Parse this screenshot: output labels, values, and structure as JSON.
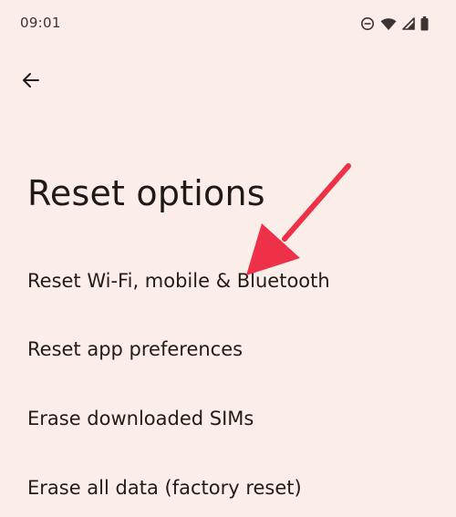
{
  "status_bar": {
    "time": "09:01",
    "icons": [
      "do-not-disturb-icon",
      "wifi-icon",
      "cellular-signal-icon",
      "battery-icon"
    ]
  },
  "header": {
    "back_icon": "arrow-left-icon"
  },
  "page": {
    "title": "Reset options"
  },
  "options": [
    {
      "label": "Reset Wi-Fi, mobile & Bluetooth"
    },
    {
      "label": "Reset app preferences"
    },
    {
      "label": "Erase downloaded SIMs"
    },
    {
      "label": "Erase all data (factory reset)"
    }
  ],
  "annotation": {
    "arrow_color": "#ef3049"
  },
  "colors": {
    "background": "#fbede7",
    "text": "#1f1a18"
  }
}
